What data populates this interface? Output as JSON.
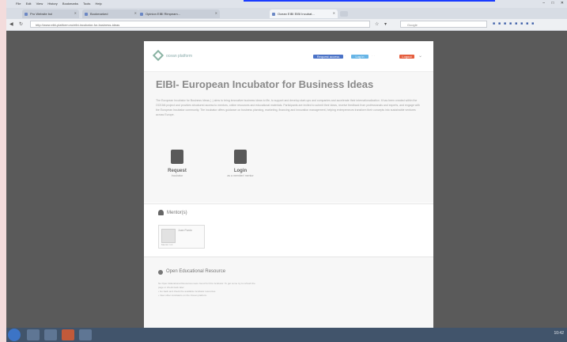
{
  "browser": {
    "menu": [
      "File",
      "Edit",
      "View",
      "History",
      "Bookmarks",
      "Tools",
      "Help"
    ],
    "tabs": [
      {
        "label": "Pro Website bol"
      },
      {
        "label": "Bookmarked"
      },
      {
        "label": "Opinion EIBI Rimpeam..."
      },
      {
        "label": "Ocean EIBI EIBI Incubat..."
      }
    ],
    "url": "http://www.eibi-platform.eu/eibi-incubator-for-business-ideas",
    "search_placeholder": "Google"
  },
  "site": {
    "logo_text": "ocean platform",
    "header_buttons": [
      "Request access",
      "Log in",
      "Logout"
    ],
    "title": "EIBI- European Incubator for Business Ideas",
    "description": "The European Incubator for Business Ideas (..) aims to bring innovative business ideas to life, to support and develop start-ups and companies and accelerate their internationalization. It has been created within the OCEAN project and provides structured access to mentors, online resources and educational materials. Participants are invited to submit their ideas, receive feedback from professionals and experts, and engage with the European Incubator community. The incubator offers guidance on business planning, marketing, financing and innovation management, helping entrepreneurs transform their concepts into sustainable ventures across Europe.",
    "actions": [
      {
        "label": "Request",
        "sub": "Incubator"
      },
      {
        "label": "Login",
        "sub": "as a member/ mentor"
      }
    ],
    "mentors": {
      "title": "Mentor(s)",
      "card_name": "Juan Pardo",
      "card_sub": "Mentor 1.0"
    },
    "oer": {
      "title": "Open Educational Resource",
      "lines": [
        "No Open Educational Resources were found for this incubator. To get some try to refresh the",
        "page or check back later",
        "• Go back and check the available incubator resources",
        "• View other incubators on the Ocean platform"
      ]
    }
  },
  "taskbar": {
    "clock": "10:42"
  }
}
